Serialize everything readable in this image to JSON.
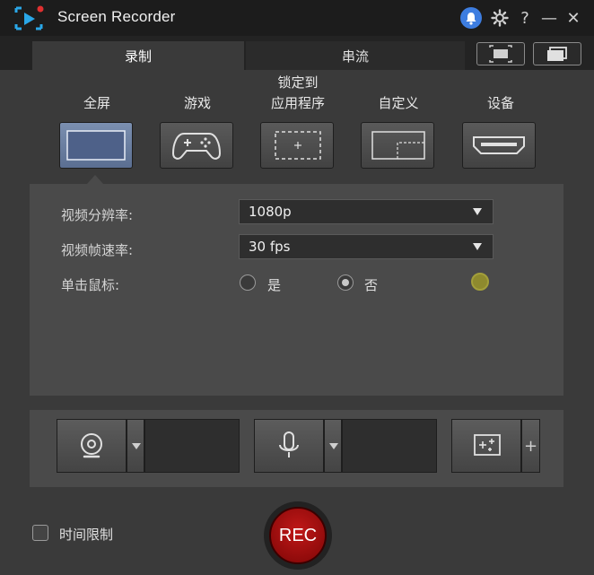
{
  "app": {
    "title": "Screen Recorder"
  },
  "titlebar": {
    "help_label": "?",
    "minimize_label": "—",
    "close_label": "✕"
  },
  "tabs": [
    {
      "label": "录制",
      "active": true
    },
    {
      "label": "串流",
      "active": false
    }
  ],
  "modes": [
    {
      "label": "全屏",
      "active": true,
      "icon": "fullscreen-icon"
    },
    {
      "label": "游戏",
      "active": false,
      "icon": "gamepad-icon"
    },
    {
      "label_line1": "锁定到",
      "label_line2": "应用程序",
      "active": false,
      "icon": "app-lock-icon"
    },
    {
      "label": "自定义",
      "active": false,
      "icon": "custom-area-icon"
    },
    {
      "label": "设备",
      "active": false,
      "icon": "hdmi-device-icon"
    }
  ],
  "settings": {
    "resolution_label": "视频分辨率:",
    "resolution_value": "1080p",
    "framerate_label": "视频帧速率:",
    "framerate_value": "30 fps",
    "mouse_click_label": "单击鼠标:",
    "option_yes": "是",
    "option_no": "否",
    "selected": "否"
  },
  "devices": {
    "plus_label": "+"
  },
  "bottom": {
    "time_limit_label": "时间限制",
    "rec_label": "REC"
  },
  "colors": {
    "accent_bell": "#3d7de0",
    "rec": "#b01010",
    "active_mode": "#6b7fa2",
    "click_indicator": "#8e8a2e"
  }
}
